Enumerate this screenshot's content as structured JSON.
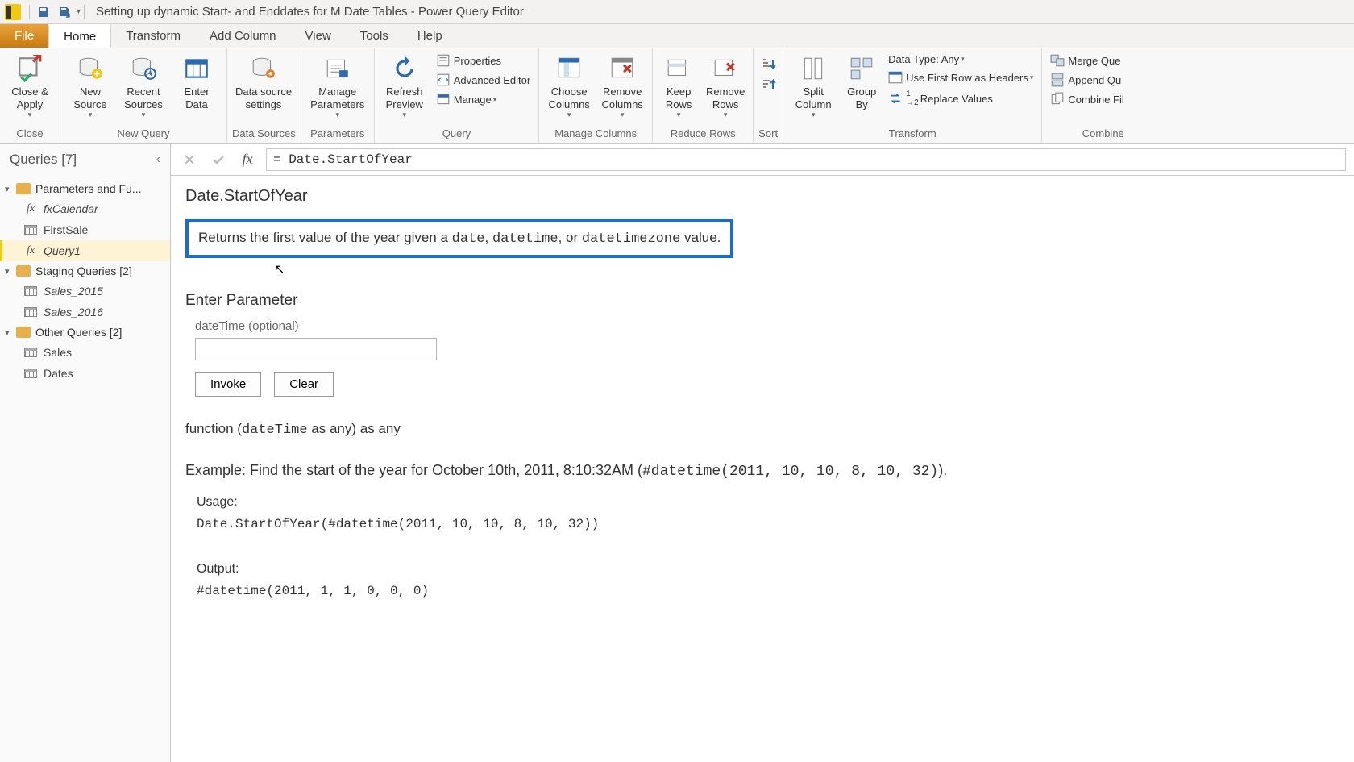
{
  "titlebar": {
    "title": "Setting up dynamic Start- and Enddates for M Date Tables - Power Query Editor"
  },
  "tabs": {
    "file": "File",
    "home": "Home",
    "transform": "Transform",
    "addcolumn": "Add Column",
    "view": "View",
    "tools": "Tools",
    "help": "Help"
  },
  "ribbon": {
    "close_apply": "Close &\nApply",
    "close_group": "Close",
    "new_source": "New\nSource",
    "recent_sources": "Recent\nSources",
    "enter_data": "Enter\nData",
    "new_query_group": "New Query",
    "data_source_settings": "Data source\nsettings",
    "data_sources_group": "Data Sources",
    "manage_parameters": "Manage\nParameters",
    "parameters_group": "Parameters",
    "refresh_preview": "Refresh\nPreview",
    "properties": "Properties",
    "advanced_editor": "Advanced Editor",
    "manage": "Manage",
    "query_group": "Query",
    "choose_columns": "Choose\nColumns",
    "remove_columns": "Remove\nColumns",
    "manage_columns_group": "Manage Columns",
    "keep_rows": "Keep\nRows",
    "remove_rows": "Remove\nRows",
    "reduce_rows_group": "Reduce Rows",
    "sort_group": "Sort",
    "split_column": "Split\nColumn",
    "group_by": "Group\nBy",
    "data_type": "Data Type: Any",
    "first_row_headers": "Use First Row as Headers",
    "replace_values": "Replace Values",
    "transform_group": "Transform",
    "merge_queries": "Merge Que",
    "append_queries": "Append Qu",
    "combine_files": "Combine Fil",
    "combine_group": "Combine"
  },
  "sidebar": {
    "header": "Queries [7]",
    "group1": "Parameters and Fu...",
    "fxCalendar": "fxCalendar",
    "firstSale": "FirstSale",
    "query1": "Query1",
    "group2": "Staging Queries [2]",
    "sales2015": "Sales_2015",
    "sales2016": "Sales_2016",
    "group3": "Other Queries [2]",
    "sales": "Sales",
    "dates": "Dates"
  },
  "formula": {
    "value": "= Date.StartOfYear"
  },
  "doc": {
    "title": "Date.StartOfYear",
    "desc_pre": "Returns the first value of the year given a ",
    "desc_t1": "date",
    "desc_sep1": ", ",
    "desc_t2": "datetime",
    "desc_sep2": ", or ",
    "desc_t3": "datetimezone",
    "desc_post": " value.",
    "enter_param": "Enter Parameter",
    "param_label": "dateTime (optional)",
    "invoke": "Invoke",
    "clear": "Clear",
    "sig_pre": "function (",
    "sig_arg": "dateTime",
    "sig_post": " as any) as any",
    "example_pre": "Example: Find the start of the year for October 10th, 2011, 8:10:32AM (",
    "example_code": "#datetime(2011, 10, 10, 8, 10, 32)",
    "example_post": ").",
    "usage_label": "Usage:",
    "usage_code": "Date.StartOfYear(#datetime(2011, 10, 10, 8, 10, 32))",
    "output_label": "Output:",
    "output_code": "#datetime(2011, 1, 1, 0, 0, 0)"
  }
}
